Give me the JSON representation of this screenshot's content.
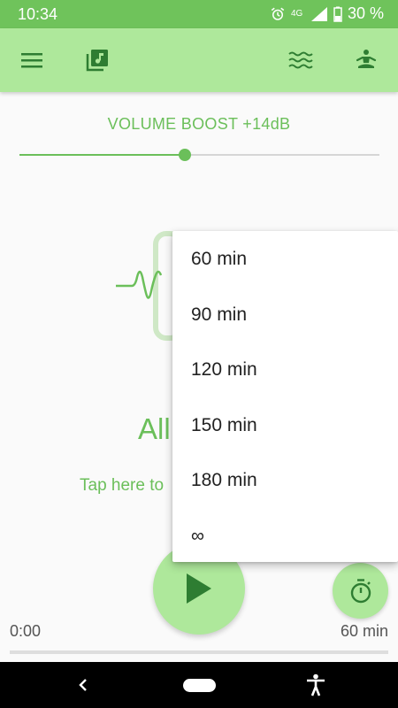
{
  "status_bar": {
    "time": "10:34",
    "network": "4G",
    "battery": "30 %",
    "icons": [
      "alarm-icon",
      "network-icon",
      "signal-icon",
      "battery-icon"
    ]
  },
  "app_bar": {
    "icons": [
      "menu-icon",
      "music-library-icon",
      "waves-icon",
      "meditation-icon"
    ],
    "background": "#aee89b"
  },
  "volume": {
    "label": "VOLUME BOOST +14dB",
    "level": 0.46
  },
  "main": {
    "title": "All",
    "hint": "Tap here to"
  },
  "player": {
    "elapsed": "0:00",
    "duration": "60 min",
    "progress": 0
  },
  "timer_menu": {
    "options": [
      "60 min",
      "90 min",
      "120 min",
      "150 min",
      "180 min",
      "∞"
    ]
  },
  "nav_bar": {
    "icons": [
      "back-icon",
      "home-icon",
      "accessibility-icon"
    ]
  },
  "colors": {
    "accent": "#6bbf5a",
    "status_bar": "#6fc35b",
    "app_bar": "#aee89b",
    "icon_dark": "#2e7d32"
  }
}
